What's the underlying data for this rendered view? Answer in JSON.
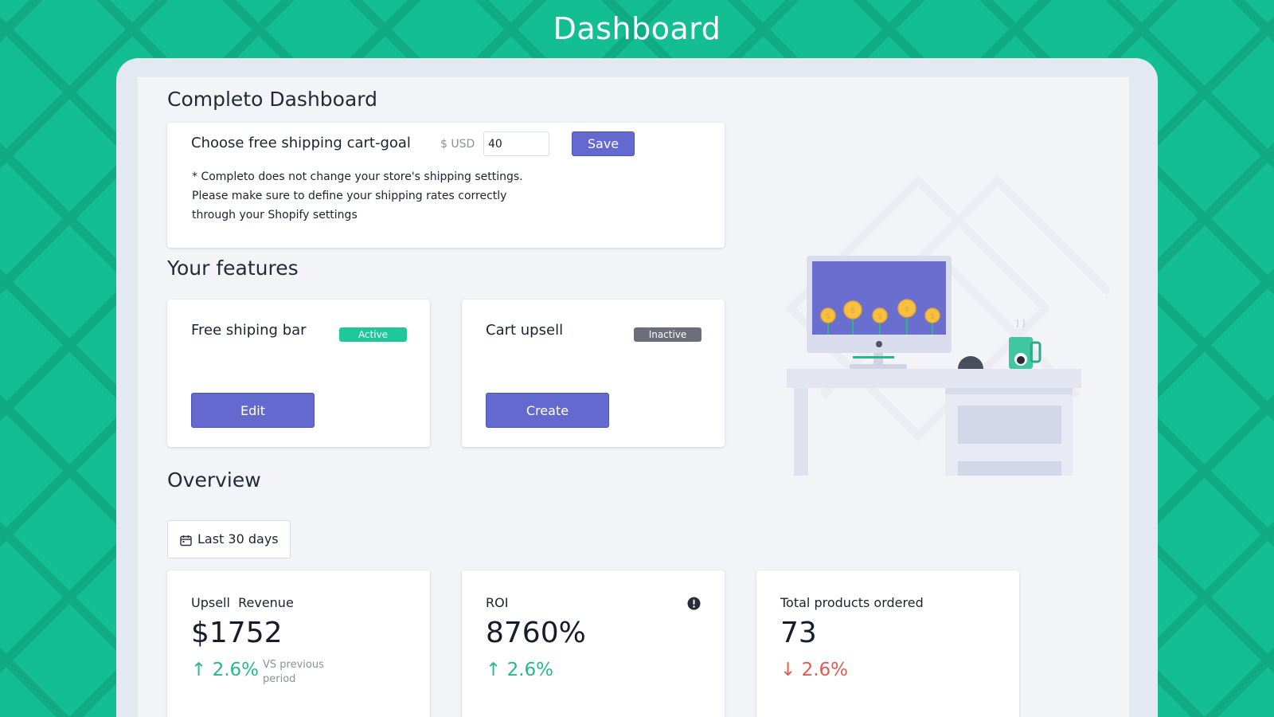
{
  "header": {
    "title": "Dashboard"
  },
  "dashboard": {
    "title": "Completo Dashboard"
  },
  "shipping_goal": {
    "heading": "Choose free shipping cart-goal",
    "currency_label": "$ USD",
    "value": "40",
    "save_label": "Save",
    "note_line1": "* Completo does not change your store's shipping settings.",
    "note_line2": "Please make sure to define your shipping rates correctly",
    "note_line3": "through your Shopify settings"
  },
  "features": {
    "title": "Your features",
    "items": [
      {
        "name": "Free shiping bar",
        "status": "Active",
        "button": "Edit"
      },
      {
        "name": "Cart upsell",
        "status": "Inactive",
        "button": "Create"
      }
    ]
  },
  "overview": {
    "title": "Overview",
    "date_filter": "Last 30 days",
    "stats": [
      {
        "label": "Upsell  Revenue",
        "value": "$1752",
        "trend": "↑ 2.6%",
        "note": "VS previous period"
      },
      {
        "label": "ROI",
        "value": "8760%",
        "trend": "↑ 2.6%"
      },
      {
        "label": "Total products ordered",
        "value": "73",
        "trend": "↓ 2.6%"
      }
    ]
  },
  "colors": {
    "background": "#14be93",
    "accent": "#6369cf",
    "active": "#1fc79a",
    "inactive": "#6b6f7c",
    "up": "#28b88d",
    "down": "#e05c52"
  }
}
